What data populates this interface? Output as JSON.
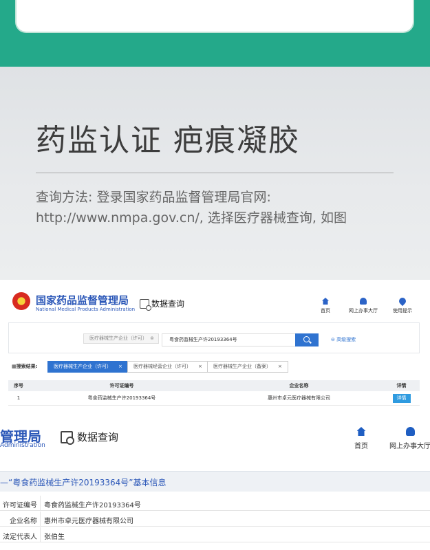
{
  "hero": {
    "title": "药监认证 疤痕凝胶",
    "line1": "查询方法: 登录国家药品监督管理局官网:",
    "line2": "http://www.nmpa.gov.cn/, 选择医疗器械查询, 如图"
  },
  "site": {
    "org_name": "国家药品监督管理局",
    "org_en": "National Medical Products Administration",
    "data_query": "数据查询",
    "nav": [
      "首页",
      "网上办事大厅",
      "使用提示"
    ]
  },
  "search": {
    "category_chip": "医疗器械生产企业（许可）",
    "chip_close": "⊗",
    "query_value": "粤食药监械生产许20193364号",
    "advanced": "⊖ 高级搜索"
  },
  "results": {
    "label": "▦搜索结果:",
    "tags": [
      {
        "label": "医疗器械生产企业（许可）",
        "close": "×"
      },
      {
        "label": "医疗器械经营企业（许可）",
        "close": "×"
      },
      {
        "label": "医疗器械生产企业（备案）",
        "close": "×"
      }
    ],
    "columns": [
      "序号",
      "许可证编号",
      "企业名称",
      "详情"
    ],
    "rows": [
      {
        "no": "1",
        "license": "粤食药监械生产许20193364号",
        "company": "惠州市卓元医疗器械有限公司",
        "detail": "详情"
      }
    ]
  },
  "detail_page": {
    "org_name_partial": "管理局",
    "org_en_partial": "Administration",
    "data_query": "数据查询",
    "nav": [
      "首页",
      "网上办事大厅"
    ],
    "section_title": "—“粤食药监械生产许20193364号”基本信息",
    "fields": [
      {
        "key": "许可证编号",
        "value": "粤食药监械生产许20193364号"
      },
      {
        "key": "企业名称",
        "value": "惠州市卓元医疗器械有限公司"
      },
      {
        "key": "法定代表人",
        "value": "张伯生"
      }
    ]
  }
}
